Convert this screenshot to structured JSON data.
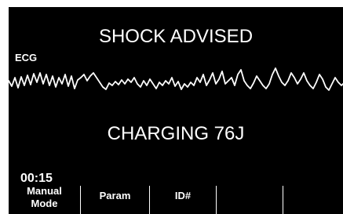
{
  "display": {
    "advisory": "SHOCK ADVISED",
    "charge_status": "CHARGING 76J",
    "lead_label": "ECG",
    "elapsed_time": "00:15"
  },
  "softkeys": [
    {
      "line1": "Manual",
      "line2": "Mode"
    },
    {
      "line1": "",
      "line2": "Param"
    },
    {
      "line1": "",
      "line2": "ID#"
    },
    {
      "line1": "",
      "line2": ""
    },
    {
      "line1": "",
      "line2": ""
    }
  ],
  "colors": {
    "background": "#000000",
    "foreground": "#ffffff"
  }
}
